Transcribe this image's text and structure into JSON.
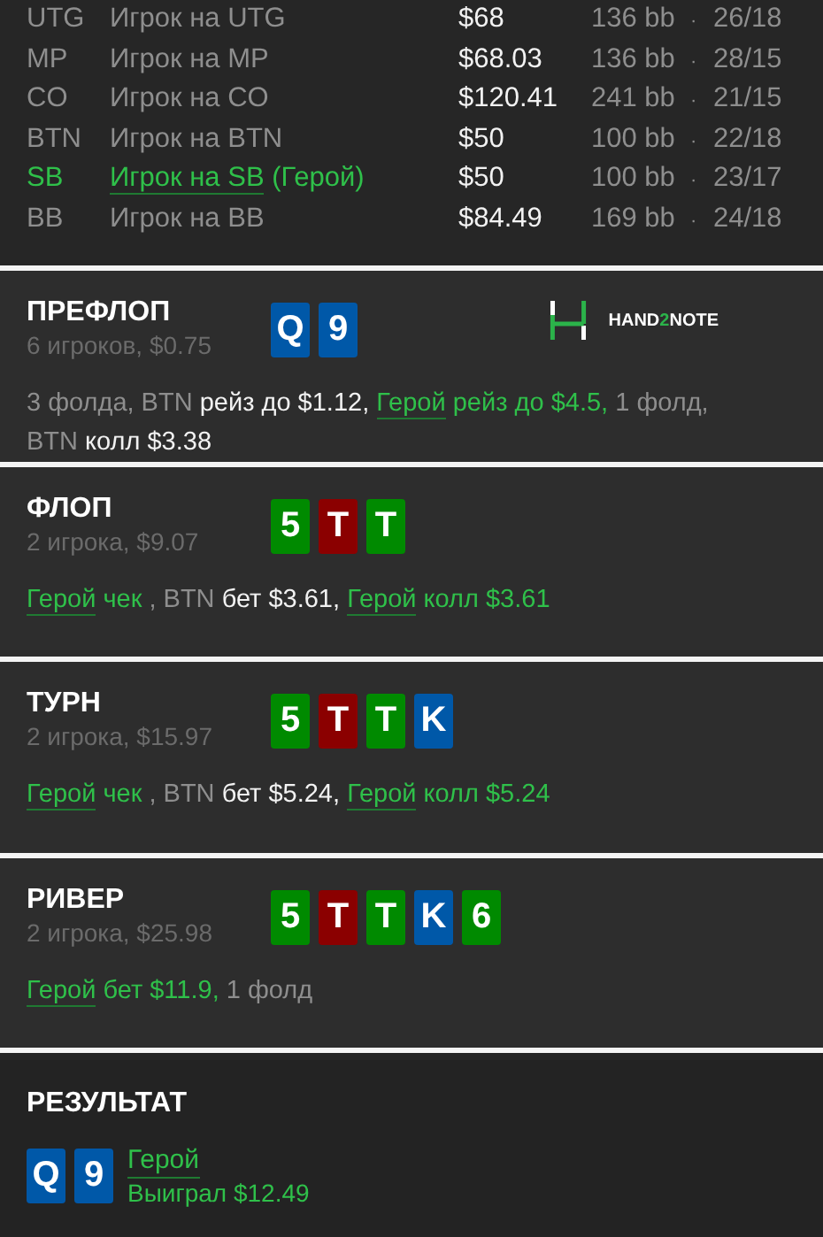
{
  "players": [
    {
      "position": "UTG",
      "name": "Игрок на UTG",
      "hero": false,
      "stack": "$68",
      "bb": "136 bb",
      "separator": "·",
      "ratio": "26/18"
    },
    {
      "position": "MP",
      "name": "Игрок на MP",
      "hero": false,
      "stack": "$68.03",
      "bb": "136 bb",
      "separator": "·",
      "ratio": "28/15"
    },
    {
      "position": "CO",
      "name": "Игрок на CO",
      "hero": false,
      "stack": "$120.41",
      "bb": "241 bb",
      "separator": "·",
      "ratio": "21/15"
    },
    {
      "position": "BTN",
      "name": "Игрок на BTN",
      "hero": false,
      "stack": "$50",
      "bb": "100 bb",
      "separator": "·",
      "ratio": "22/18"
    },
    {
      "position": "SB",
      "name": "Игрок на SB",
      "hero": true,
      "hero_tag": "(Герой)",
      "stack": "$50",
      "bb": "100 bb",
      "separator": "·",
      "ratio": "23/17"
    },
    {
      "position": "BB",
      "name": "Игрок на BB",
      "hero": false,
      "stack": "$84.49",
      "bb": "169 bb",
      "separator": "·",
      "ratio": "24/18"
    }
  ],
  "streets": [
    {
      "title": "ПРЕФЛОП",
      "info": "6 игроков, $0.75",
      "logo": {
        "parts": [
          {
            "text": "HAND",
            "accent": false
          },
          {
            "text": "2",
            "accent": true
          },
          {
            "text": "NOTE",
            "accent": false
          }
        ]
      },
      "cards": [
        {
          "rank": "Q",
          "color": "#0058a8"
        },
        {
          "rank": "9",
          "color": "#0058a8"
        }
      ],
      "action": [
        {
          "text": "3 фолда, BTN ",
          "kind": "grey"
        },
        {
          "text": "рейз до $1.12, ",
          "kind": "white"
        },
        {
          "text": "Герой",
          "kind": "link"
        },
        {
          "text": " рейз до $4.5,",
          "kind": "green"
        },
        {
          "text": " 1 фолд, BTN ",
          "kind": "grey"
        },
        {
          "text": "колл $3.38",
          "kind": "white"
        }
      ]
    },
    {
      "title": "ФЛОП",
      "info": "2 игрока, $9.07",
      "cards": [
        {
          "rank": "5",
          "color": "#008a00"
        },
        {
          "rank": "T",
          "color": "#8b0000"
        },
        {
          "rank": "T",
          "color": "#008a00"
        }
      ],
      "action": [
        {
          "text": "Герой",
          "kind": "link"
        },
        {
          "text": " чек ",
          "kind": "green"
        },
        {
          "text": ", BTN ",
          "kind": "grey"
        },
        {
          "text": "бет $3.61, ",
          "kind": "white"
        },
        {
          "text": "Герой",
          "kind": "link"
        },
        {
          "text": " колл $3.61",
          "kind": "green"
        }
      ]
    },
    {
      "title": "ТУРН",
      "info": "2 игрока, $15.97",
      "cards": [
        {
          "rank": "5",
          "color": "#008a00"
        },
        {
          "rank": "T",
          "color": "#8b0000"
        },
        {
          "rank": "T",
          "color": "#008a00"
        },
        {
          "rank": "K",
          "color": "#0058a8"
        }
      ],
      "action": [
        {
          "text": "Герой",
          "kind": "link"
        },
        {
          "text": " чек ",
          "kind": "green"
        },
        {
          "text": ", BTN ",
          "kind": "grey"
        },
        {
          "text": "бет $5.24, ",
          "kind": "white"
        },
        {
          "text": "Герой",
          "kind": "link"
        },
        {
          "text": " колл $5.24",
          "kind": "green"
        }
      ]
    },
    {
      "title": "РИВЕР",
      "info": "2 игрока, $25.98",
      "cards": [
        {
          "rank": "5",
          "color": "#008a00"
        },
        {
          "rank": "T",
          "color": "#8b0000"
        },
        {
          "rank": "T",
          "color": "#008a00"
        },
        {
          "rank": "K",
          "color": "#0058a8"
        },
        {
          "rank": "6",
          "color": "#008a00"
        }
      ],
      "action": [
        {
          "text": "Герой",
          "kind": "link"
        },
        {
          "text": " бет $11.9,",
          "kind": "green"
        },
        {
          "text": " 1 фолд",
          "kind": "grey"
        }
      ]
    }
  ],
  "result": {
    "title": "РЕЗУЛЬТАТ",
    "cards": [
      {
        "rank": "Q",
        "color": "#0058a8"
      },
      {
        "rank": "9",
        "color": "#0058a8"
      }
    ],
    "player": "Герой",
    "outcome": "Выиграл $12.49"
  }
}
